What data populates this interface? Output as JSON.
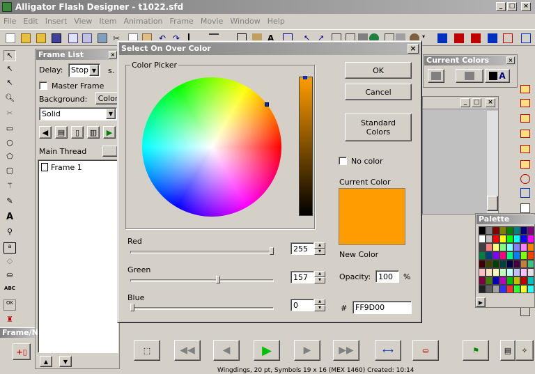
{
  "app": {
    "title": "Alligator Flash Designer - t1022.sfd"
  },
  "menu": [
    "File",
    "Edit",
    "Insert",
    "View",
    "Item",
    "Animation",
    "Frame",
    "Movie",
    "Window",
    "Help"
  ],
  "frame_list": {
    "title": "Frame List",
    "delay_label": "Delay:",
    "delay_value": "Stop",
    "delay_unit": "s.",
    "master_frame": "Master Frame",
    "background_label": "Background:",
    "color_button": "Color",
    "background_value": "Solid",
    "main_thread": "Main Thread",
    "frame_item": "Frame 1"
  },
  "current_colors": {
    "title": "Current Colors"
  },
  "palette": {
    "title": "Palette",
    "colors": [
      "#000000",
      "#808080",
      "#800000",
      "#808000",
      "#008000",
      "#008080",
      "#000080",
      "#800080",
      "#ffffff",
      "#c0c0c0",
      "#ff0000",
      "#ffff00",
      "#00ff00",
      "#00ffff",
      "#0000ff",
      "#ff00ff",
      "#404040",
      "#ff8080",
      "#ffff80",
      "#80ff80",
      "#80ffff",
      "#8080ff",
      "#ff80ff",
      "#ff8000",
      "#008040",
      "#004080",
      "#8000ff",
      "#ff0080",
      "#00ff80",
      "#0080ff",
      "#80ff00",
      "#ff4000",
      "#400000",
      "#404000",
      "#004000",
      "#004040",
      "#000040",
      "#400040",
      "#c08040",
      "#40c080",
      "#ffc0c0",
      "#ffe0c0",
      "#ffffc0",
      "#c0ffc0",
      "#c0ffff",
      "#c0c0ff",
      "#ffc0ff",
      "#e0e0e0",
      "#800040",
      "#408000",
      "#0000c0",
      "#c000c0",
      "#00c000",
      "#c0c000",
      "#c00000",
      "#00c0c0",
      "#202020",
      "#606060",
      "#a0a0a0",
      "#3030ff",
      "#ff3030",
      "#30ff30",
      "#ffff30",
      "#30ffff"
    ]
  },
  "frame_bar": {
    "label": "Frame/N"
  },
  "status": {
    "text": "Wingdings, 20 pt, Symbols 19 x 16 (MEX 1460) Created: 10:14"
  },
  "dialog": {
    "title": "Select On Over Color",
    "group_label": "Color Picker",
    "ok": "OK",
    "cancel": "Cancel",
    "standard_colors": "Standard\nColors",
    "no_color": "No color",
    "current_color_label": "Current Color",
    "current_color": "#FF9D00",
    "new_color_label": "New Color",
    "opacity_label": "Opacity:",
    "opacity_value": "100",
    "opacity_unit": "%",
    "hash": "#",
    "hex_value": "FF9D00",
    "red_label": "Red",
    "red_value": "255",
    "red_fraction": 1.0,
    "green_label": "Green",
    "green_value": "157",
    "green_fraction": 0.616,
    "blue_label": "Blue",
    "blue_value": "0",
    "blue_fraction": 0.0
  }
}
